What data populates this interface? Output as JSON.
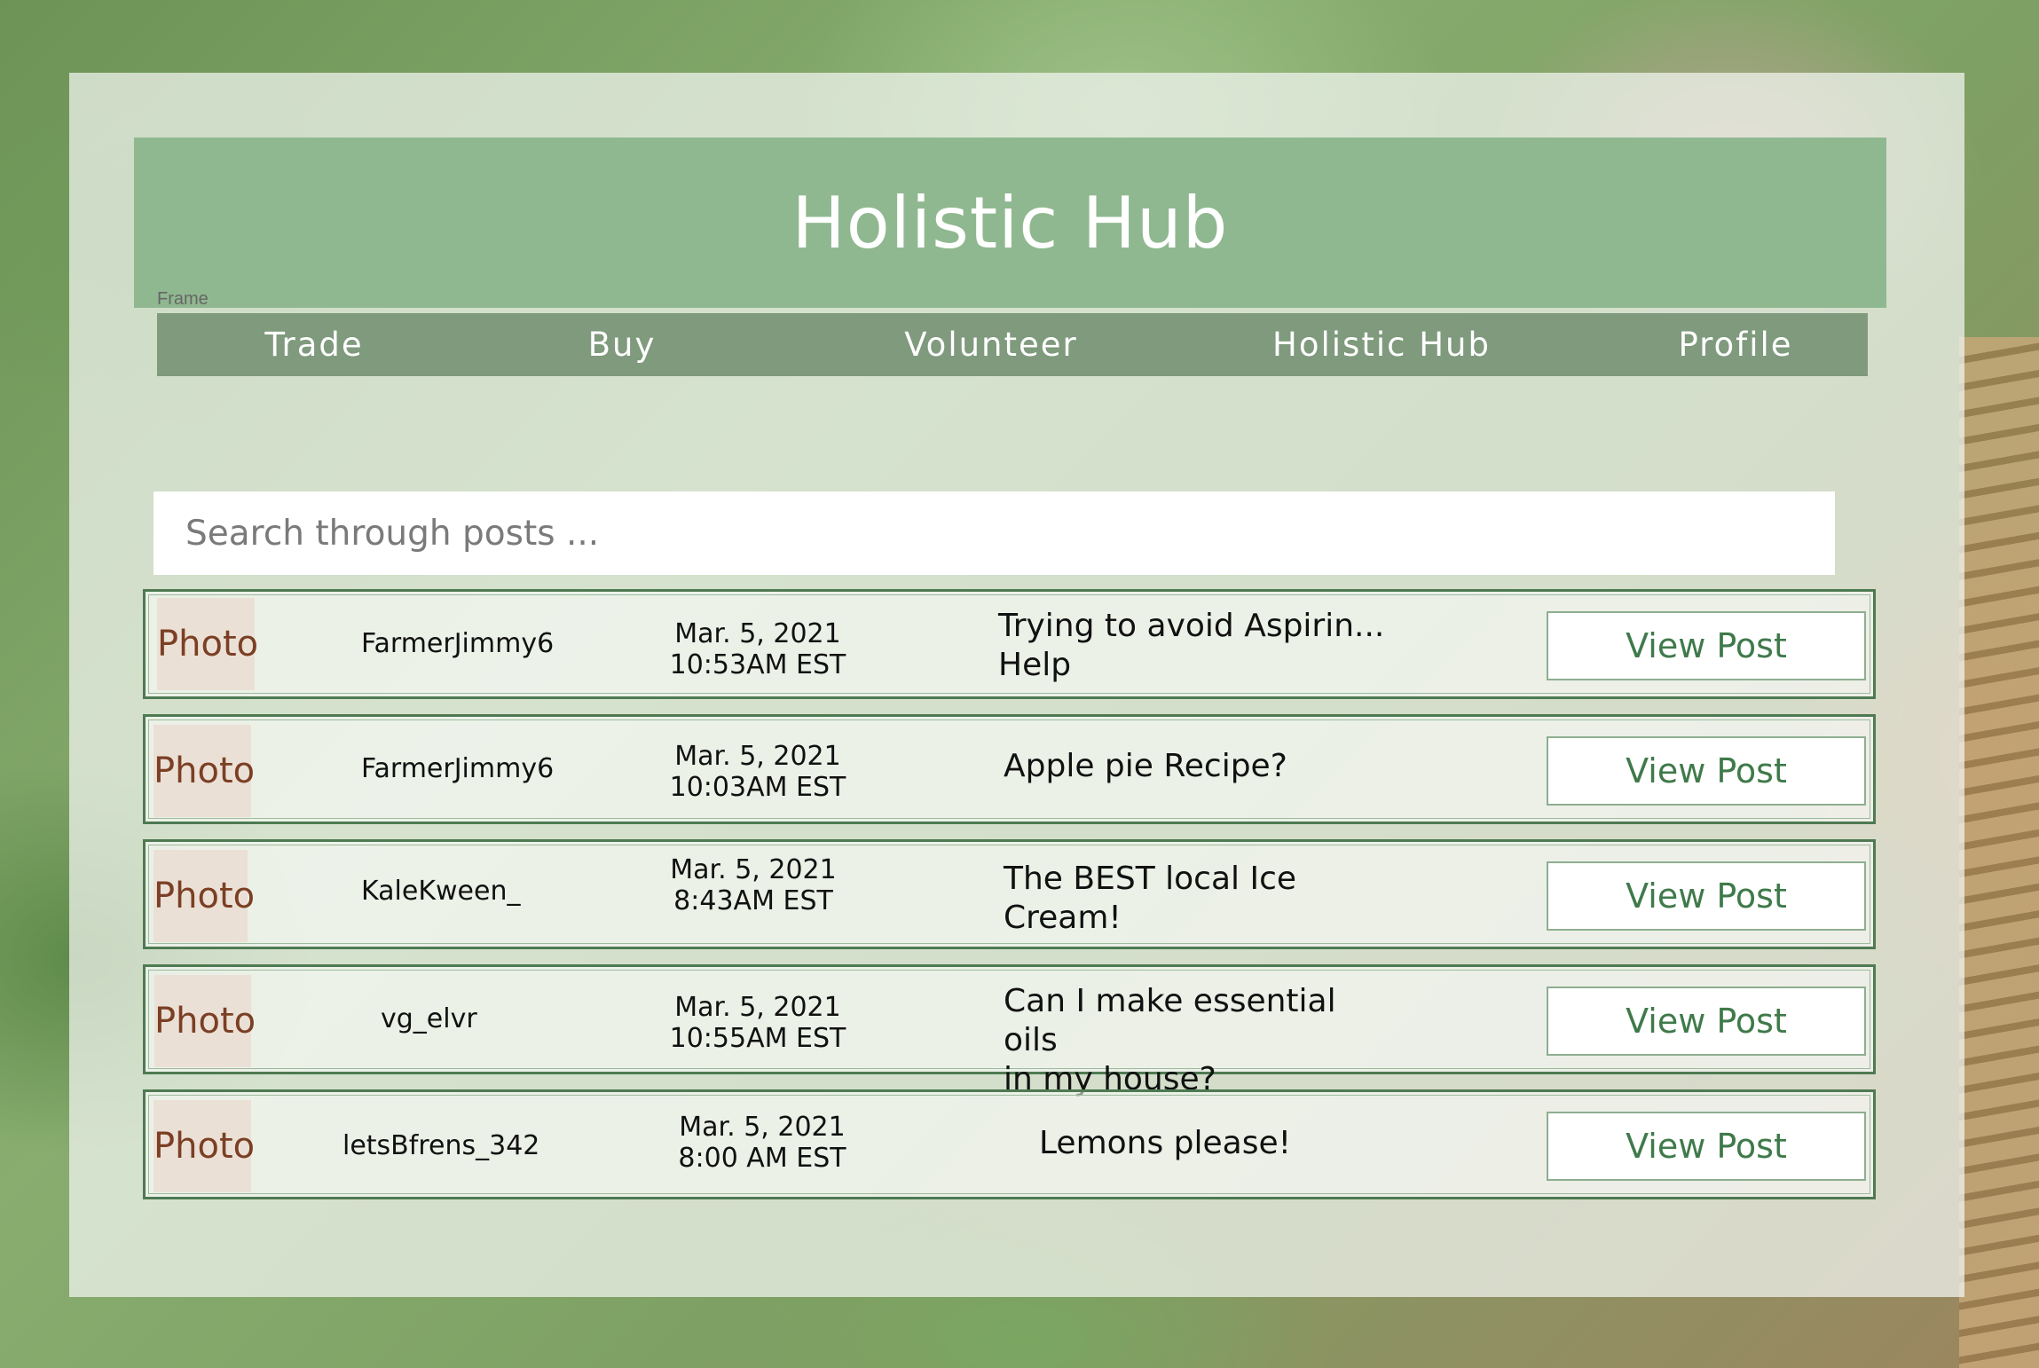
{
  "header": {
    "title": "Holistic Hub",
    "frame_label": "Frame"
  },
  "nav": {
    "items": [
      {
        "label": "Trade"
      },
      {
        "label": "Buy"
      },
      {
        "label": "Volunteer"
      },
      {
        "label": "Holistic Hub"
      },
      {
        "label": "Profile"
      }
    ]
  },
  "search": {
    "placeholder": "Search through posts ...",
    "value": ""
  },
  "posts": [
    {
      "photo": "Photo",
      "username": "FarmerJimmy6",
      "date": "Mar. 5,  2021",
      "time": "10:53AM EST",
      "title_line1": "Trying to avoid Aspirin...",
      "title_line2": "Help",
      "button": "View Post"
    },
    {
      "photo": "Photo",
      "username": "FarmerJimmy6",
      "date": "Mar. 5,  2021",
      "time": "10:03AM EST",
      "title_line1": "Apple pie Recipe?",
      "title_line2": "",
      "button": "View Post"
    },
    {
      "photo": "Photo",
      "username": "KaleKween_",
      "date": "Mar. 5,  2021",
      "time": "8:43AM EST",
      "title_line1": "The BEST local Ice",
      "title_line2": "Cream!",
      "button": "View Post"
    },
    {
      "photo": "Photo",
      "username": "vg_elvr",
      "date": "Mar. 5,  2021",
      "time": "10:55AM EST",
      "title_line1": "Can I make essential oils",
      "title_line2": "in my house?",
      "button": "View Post"
    },
    {
      "photo": "Photo",
      "username": "letsBfrens_342",
      "date": "Mar. 5,  2021",
      "time": "8:00 AM EST",
      "title_line1": "Lemons please!",
      "title_line2": "",
      "button": "View Post"
    }
  ],
  "colors": {
    "title_bar": "#90b890",
    "nav_bar": "#7f9a7d",
    "row_border": "#4e7a52",
    "button_text": "#3f7a4a",
    "photo_bg": "#ebe0d6",
    "photo_text": "#7b3f24"
  }
}
